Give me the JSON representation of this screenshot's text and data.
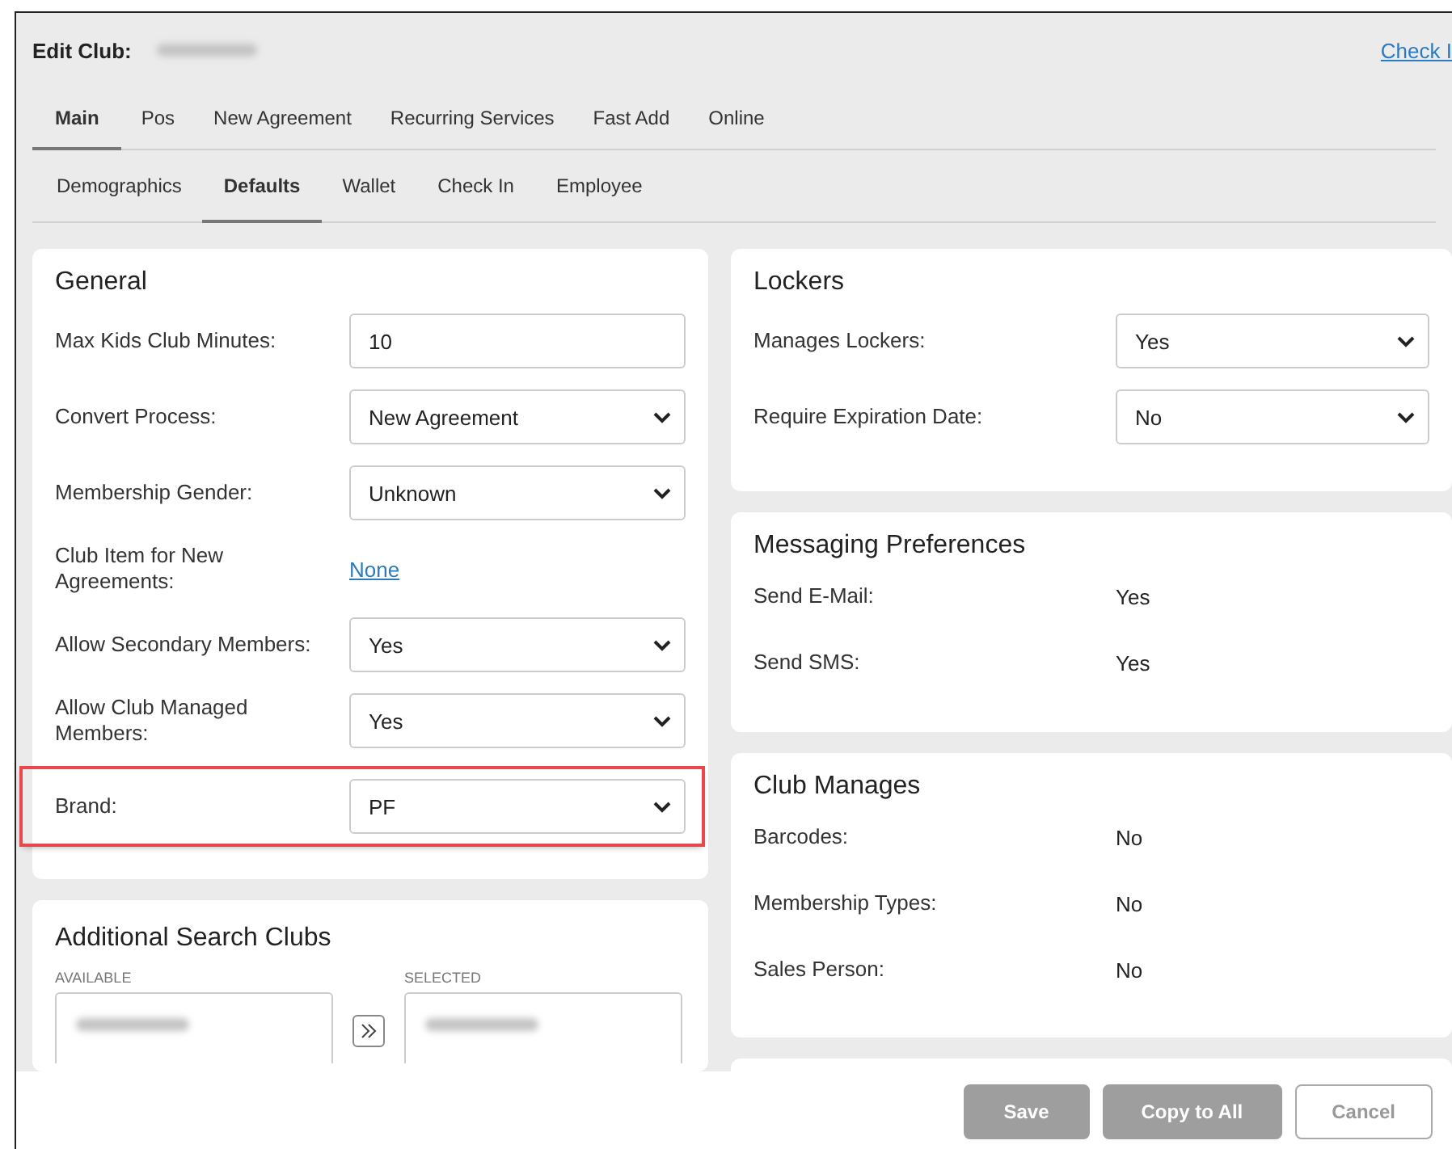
{
  "header": {
    "title": "Edit Club:",
    "check_in_link": "Check I"
  },
  "main_tabs": [
    {
      "label": "Main",
      "selected": true
    },
    {
      "label": "Pos",
      "selected": false
    },
    {
      "label": "New Agreement",
      "selected": false
    },
    {
      "label": "Recurring Services",
      "selected": false
    },
    {
      "label": "Fast Add",
      "selected": false
    },
    {
      "label": "Online",
      "selected": false
    }
  ],
  "sub_tabs": [
    {
      "label": "Demographics",
      "selected": false
    },
    {
      "label": "Defaults",
      "selected": true
    },
    {
      "label": "Wallet",
      "selected": false
    },
    {
      "label": "Check In",
      "selected": false
    },
    {
      "label": "Employee",
      "selected": false
    }
  ],
  "general": {
    "title": "General",
    "fields": [
      {
        "label": "Max Kids Club Minutes:",
        "kind": "text",
        "value": "10",
        "highlighted": false
      },
      {
        "label": "Convert Process:",
        "kind": "select",
        "value": "New Agreement",
        "highlighted": false
      },
      {
        "label": "Membership Gender:",
        "kind": "select",
        "value": "Unknown",
        "highlighted": false
      },
      {
        "label": "Club Item for New Agreements:",
        "kind": "link",
        "value": "None",
        "highlighted": false
      },
      {
        "label": "Allow Secondary Members:",
        "kind": "select",
        "value": "Yes",
        "highlighted": false
      },
      {
        "label": "Allow Club Managed Members:",
        "kind": "select",
        "value": "Yes",
        "highlighted": false
      },
      {
        "label": "Brand:",
        "kind": "select",
        "value": "PF",
        "highlighted": true
      }
    ]
  },
  "search_clubs": {
    "title": "Additional Search Clubs",
    "available_label": "AVAILABLE",
    "selected_label": "SELECTED"
  },
  "lockers": {
    "title": "Lockers",
    "fields": [
      {
        "label": "Manages Lockers:",
        "kind": "select",
        "value": "Yes"
      },
      {
        "label": "Require Expiration Date:",
        "kind": "select",
        "value": "No"
      }
    ]
  },
  "messaging": {
    "title": "Messaging Preferences",
    "fields": [
      {
        "label": "Send E-Mail:",
        "kind": "readonly",
        "value": "Yes"
      },
      {
        "label": "Send SMS:",
        "kind": "readonly",
        "value": "Yes"
      }
    ]
  },
  "club_manages": {
    "title": "Club Manages",
    "fields": [
      {
        "label": "Barcodes:",
        "kind": "readonly",
        "value": "No"
      },
      {
        "label": "Membership Types:",
        "kind": "readonly",
        "value": "No"
      },
      {
        "label": "Sales Person:",
        "kind": "readonly",
        "value": "No"
      }
    ]
  },
  "footer_buttons": [
    {
      "label": "Save",
      "kind": "primary"
    },
    {
      "label": "Copy to All",
      "kind": "primary"
    },
    {
      "label": "Cancel",
      "kind": "secondary"
    }
  ]
}
